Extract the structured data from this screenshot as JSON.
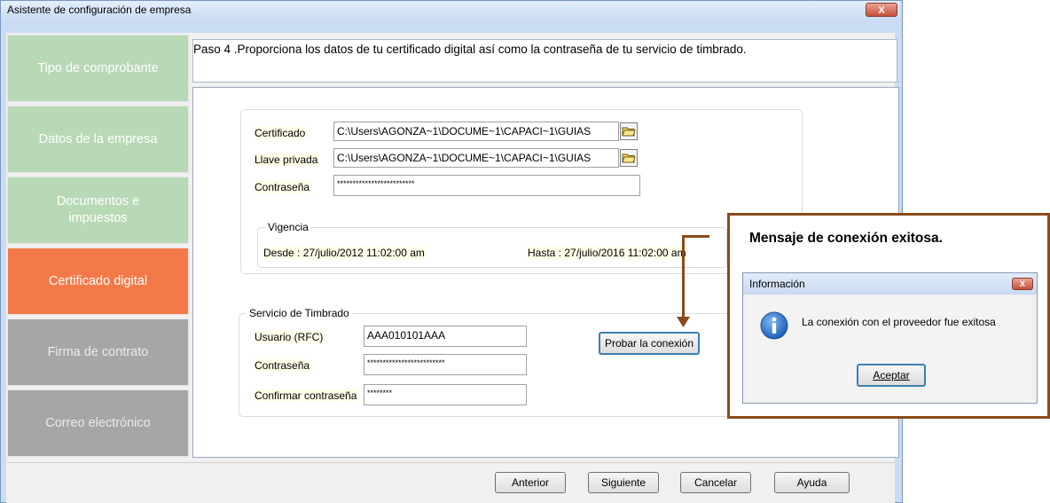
{
  "window": {
    "title": "Asistente de configuración de empresa",
    "close_label": "X"
  },
  "step_text": "Paso 4 .Proporciona los datos de tu certificado digital así como la contraseña de tu servicio de timbrado.",
  "steps": [
    {
      "label": "Tipo de comprobante",
      "state": "done"
    },
    {
      "label": "Datos de la empresa",
      "state": "done"
    },
    {
      "label": "Documentos e impuestos",
      "state": "done"
    },
    {
      "label": "Certificado digital",
      "state": "active"
    },
    {
      "label": "Firma de contrato",
      "state": "todo"
    },
    {
      "label": "Correo electrónico",
      "state": "todo"
    }
  ],
  "certificado": {
    "certificado_label": "Certificado",
    "certificado_value": "C:\\Users\\AGONZA~1\\DOCUME~1\\CAPACI~1\\GUIAS",
    "llave_label": "Llave privada",
    "llave_value": "C:\\Users\\AGONZA~1\\DOCUME~1\\CAPACI~1\\GUIAS",
    "contrasena_label": "Contraseña",
    "contrasena_value": "*************************"
  },
  "vigencia": {
    "legend": "Vigencia",
    "desde": "Desde : 27/julio/2012 11:02:00 am",
    "hasta": "Hasta : 27/julio/2016 11:02:00 am"
  },
  "timbrado": {
    "legend": "Servicio de Timbrado",
    "usuario_label": "Usuario (RFC)",
    "usuario_value": "AAA010101AAA",
    "contrasena_label": "Contraseña",
    "contrasena_value": "*************************",
    "confirmar_label": "Confirmar contraseña",
    "confirmar_value": "********",
    "probar_label": "Probar la conexión"
  },
  "footer": {
    "anterior": "Anterior",
    "siguiente": "Siguiente",
    "cancelar": "Cancelar",
    "ayuda": "Ayuda"
  },
  "callout": {
    "title": "Mensaje de conexión exitosa.",
    "dialog_title": "Información",
    "dialog_close": "X",
    "dialog_message": "La conexión con el proveedor fue exitosa",
    "dialog_button": "Aceptar"
  },
  "colors": {
    "step_done": "#b7d9b5",
    "step_active": "#f37a48",
    "step_todo": "#a6a6a6",
    "callout_border": "#8b4a1a",
    "info_icon": "#1f6fc9"
  }
}
